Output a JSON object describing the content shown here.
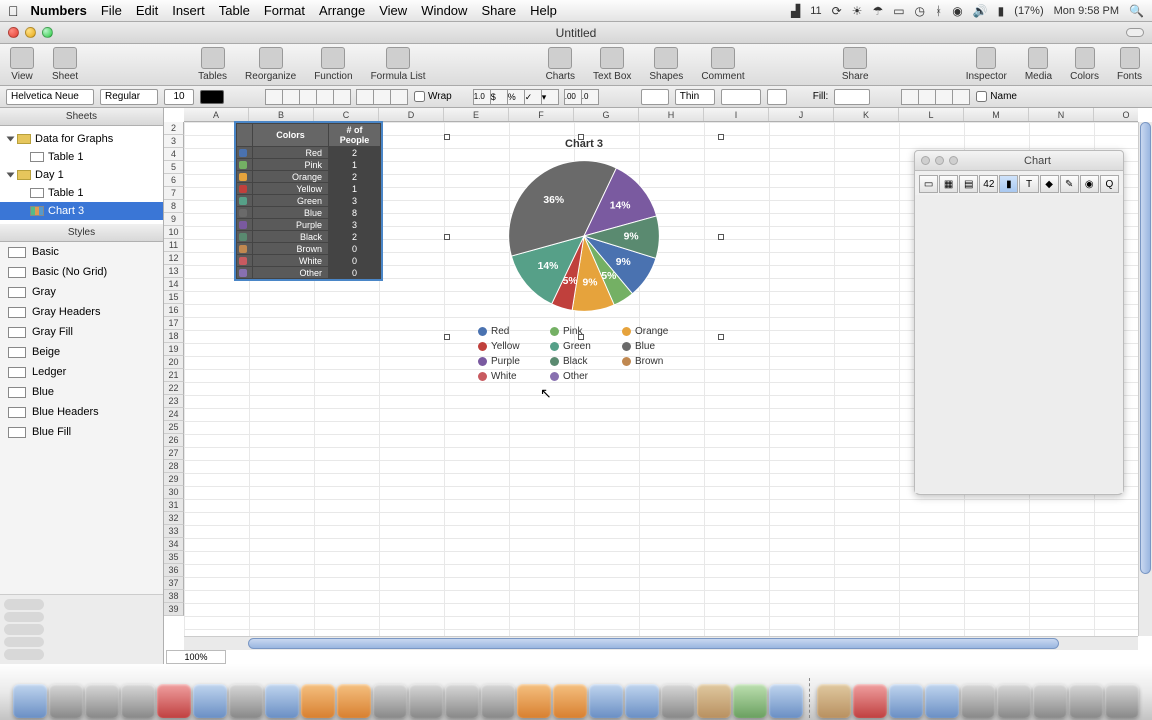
{
  "menubar": {
    "app": "Numbers",
    "items": [
      "File",
      "Edit",
      "Insert",
      "Table",
      "Format",
      "Arrange",
      "View",
      "Window",
      "Share",
      "Help"
    ],
    "right": {
      "num": "11",
      "battery": "(17%)",
      "clock": "Mon 9:58 PM"
    }
  },
  "window": {
    "title": "Untitled"
  },
  "toolbar": {
    "items_left": [
      "View",
      "Sheet"
    ],
    "items_mid1": [
      "Tables",
      "Reorganize",
      "Function",
      "Formula List"
    ],
    "items_mid2": [
      "Charts",
      "Text Box",
      "Shapes",
      "Comment"
    ],
    "share": "Share",
    "items_right": [
      "Inspector",
      "Media",
      "Colors",
      "Fonts"
    ]
  },
  "fmtbar": {
    "font": "Helvetica Neue",
    "weight": "Regular",
    "size": "10",
    "wrap": "Wrap",
    "thin": "Thin",
    "fill": "Fill:",
    "name": "Name",
    "k10": "1.0",
    "kp00": ".00",
    "kp0": ".0 "
  },
  "sidebar": {
    "sheets_label": "Sheets",
    "nodes": [
      {
        "label": "Data for Graphs",
        "kind": "sheet"
      },
      {
        "label": "Table 1",
        "kind": "table",
        "indent": true
      },
      {
        "label": "Day 1",
        "kind": "sheet"
      },
      {
        "label": "Table 1",
        "kind": "table",
        "indent": true
      },
      {
        "label": "Chart 3",
        "kind": "chart",
        "indent": true,
        "sel": true
      }
    ],
    "styles_label": "Styles",
    "styles": [
      "Basic",
      "Basic (No Grid)",
      "Gray",
      "Gray Headers",
      "Gray Fill",
      "Beige",
      "Ledger",
      "Blue",
      "Blue Headers",
      "Blue Fill"
    ]
  },
  "columns": [
    "A",
    "B",
    "C",
    "D",
    "E",
    "F",
    "G",
    "H",
    "I",
    "J",
    "K",
    "L",
    "M",
    "N",
    "O"
  ],
  "row_start": 2,
  "row_end": 39,
  "table": {
    "headers": [
      "Colors",
      "# of People"
    ],
    "rows": [
      {
        "c": "#4a72b0",
        "label": "Red",
        "v": 2
      },
      {
        "c": "#74b064",
        "label": "Pink",
        "v": 1
      },
      {
        "c": "#e6a33c",
        "label": "Orange",
        "v": 2
      },
      {
        "c": "#c0403c",
        "label": "Yellow",
        "v": 1
      },
      {
        "c": "#56a088",
        "label": "Green",
        "v": 3
      },
      {
        "c": "#6a6a6a",
        "label": "Blue",
        "v": 8
      },
      {
        "c": "#7a5aa0",
        "label": "Purple",
        "v": 3
      },
      {
        "c": "#5a8a70",
        "label": "Black",
        "v": 2
      },
      {
        "c": "#c08850",
        "label": "Brown",
        "v": 0
      },
      {
        "c": "#c85a60",
        "label": "White",
        "v": 0
      },
      {
        "c": "#8870b0",
        "label": "Other",
        "v": 0
      }
    ]
  },
  "chart_data": {
    "type": "pie",
    "title": "Chart 3",
    "categories": [
      "Red",
      "Pink",
      "Orange",
      "Yellow",
      "Green",
      "Blue",
      "Purple",
      "Black",
      "Brown",
      "White",
      "Other"
    ],
    "values": [
      2,
      1,
      2,
      1,
      3,
      8,
      3,
      2,
      0,
      0,
      0
    ],
    "percent_labels": [
      "9%",
      "5%",
      "9%",
      "5%",
      "14%",
      "36%",
      "14%",
      "9%",
      "",
      "",
      ""
    ],
    "colors": [
      "#4a72b0",
      "#74b064",
      "#e6a33c",
      "#c0403c",
      "#56a088",
      "#6a6a6a",
      "#7a5aa0",
      "#5a8a70",
      "#c08850",
      "#c85a60",
      "#8870b0"
    ]
  },
  "inspector": {
    "title": "Chart"
  },
  "zoom": "100%"
}
